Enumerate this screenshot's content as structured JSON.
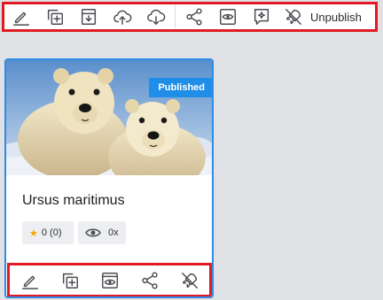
{
  "toolbar": {
    "icons": [
      "edit-icon",
      "duplicate-icon",
      "archive-icon",
      "upload-cloud-icon",
      "download-cloud-icon",
      "share-icon",
      "preview-icon",
      "comment-icon",
      "unpublish-icon"
    ],
    "unpublish_label": "Unpublish"
  },
  "card": {
    "badge": "Published",
    "title": "Ursus maritimus",
    "rating": "0 (0)",
    "views": "0x",
    "actions": [
      "edit-icon",
      "duplicate-icon",
      "archive-icon",
      "share-icon",
      "unpublish-icon"
    ]
  },
  "colors": {
    "highlight": "#e01b24",
    "accent": "#1f8ee8",
    "star": "#f0a500"
  }
}
